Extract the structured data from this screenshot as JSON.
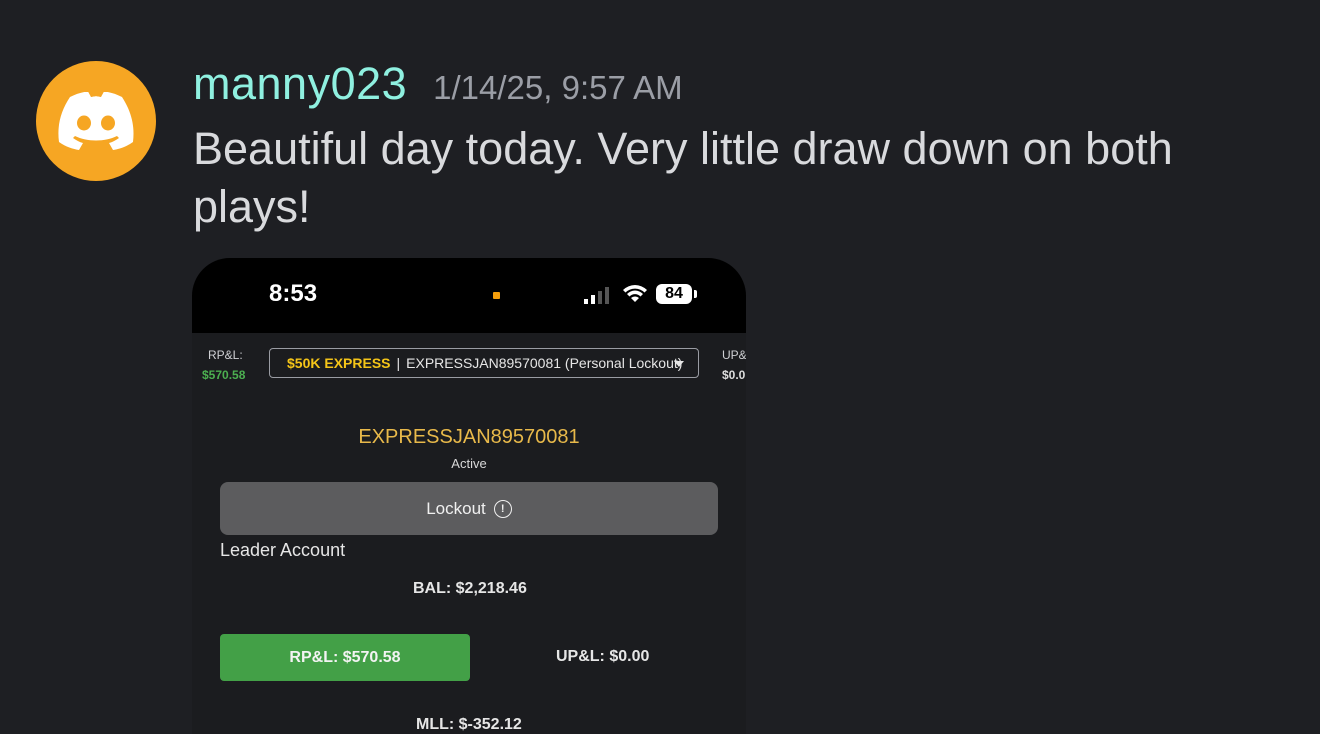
{
  "message": {
    "avatar_icon": "discord-logo-icon",
    "avatar_color": "#f6a623",
    "username": "manny023",
    "timestamp": "1/14/25, 9:57 AM",
    "text": "Beautiful day today. Very little draw down on both plays!"
  },
  "screenshot": {
    "status_bar": {
      "time": "8:53",
      "battery": "84",
      "icons": [
        "signal-icon",
        "wifi-icon",
        "battery-icon"
      ]
    },
    "rpl_label": "RP&L:",
    "rpl_value": "$570.58",
    "upl_label": "UP&",
    "upl_value": "$0.0",
    "account_select": {
      "type": "$50K EXPRESS",
      "separator": "|",
      "name": "EXPRESSJAN89570081 (Personal Lockout)"
    },
    "account_id": "EXPRESSJAN89570081",
    "account_status": "Active",
    "lockout_label": "Lockout",
    "leader_label": "Leader Account",
    "balance": "BAL: $2,218.46",
    "rpl_button": "RP&L: $570.58",
    "upl_text": "UP&L: $0.00",
    "mll_text": "MLL: $-352.12",
    "colors": {
      "username": "#8ff0e0",
      "positive": "#43a047",
      "account_type": "#f5c518",
      "account_id": "#e8b94a"
    }
  }
}
